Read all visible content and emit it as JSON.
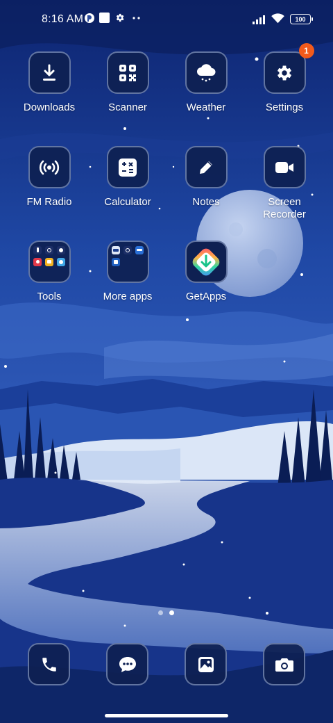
{
  "status_bar": {
    "time": "8:16 AM",
    "battery_level": "100",
    "icons": [
      "assistant-icon",
      "square-notification-icon",
      "gear-notification-icon",
      "more-dots-icon",
      "signal-icon",
      "wifi-icon",
      "battery-icon"
    ]
  },
  "apps": [
    {
      "label": "Downloads",
      "icon": "download-icon"
    },
    {
      "label": "Scanner",
      "icon": "qr-scanner-icon"
    },
    {
      "label": "Weather",
      "icon": "weather-cloud-icon"
    },
    {
      "label": "Settings",
      "icon": "gear-icon",
      "badge": "1"
    },
    {
      "label": "FM Radio",
      "icon": "radio-icon"
    },
    {
      "label": "Calculator",
      "icon": "calculator-icon"
    },
    {
      "label": "Notes",
      "icon": "pencil-icon"
    },
    {
      "label": "Screen\nRecorder",
      "icon": "video-camera-icon"
    },
    {
      "label": "Tools",
      "icon": "folder-icon"
    },
    {
      "label": "More apps",
      "icon": "folder-icon"
    },
    {
      "label": "GetApps",
      "icon": "getapps-icon"
    }
  ],
  "dock": [
    {
      "name": "phone",
      "icon": "phone-icon"
    },
    {
      "name": "messages",
      "icon": "message-bubble-icon"
    },
    {
      "name": "gallery",
      "icon": "gallery-icon"
    },
    {
      "name": "camera",
      "icon": "camera-icon"
    }
  ],
  "page_indicator": {
    "count": 2,
    "active": 1
  },
  "colors": {
    "badge": "#f25a1b",
    "icon_bg": "#0e2052",
    "sky_top": "#0d2470",
    "sky_bottom": "#2d57b5",
    "moon": "#9cb3e2"
  }
}
